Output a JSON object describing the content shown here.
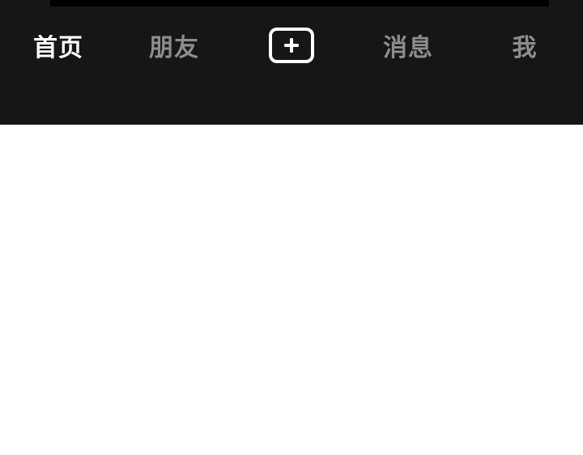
{
  "tab_bar": {
    "tabs": [
      {
        "label": "首页",
        "active": true
      },
      {
        "label": "朋友",
        "active": false
      },
      {
        "label": "",
        "icon": "plus-icon",
        "active": false
      },
      {
        "label": "消息",
        "active": false
      },
      {
        "label": "我",
        "active": false
      }
    ]
  },
  "colors": {
    "bar_background": "#161616",
    "active_text": "#ffffff",
    "inactive_text": "#8d8d8d",
    "content_background": "#ffffff"
  }
}
